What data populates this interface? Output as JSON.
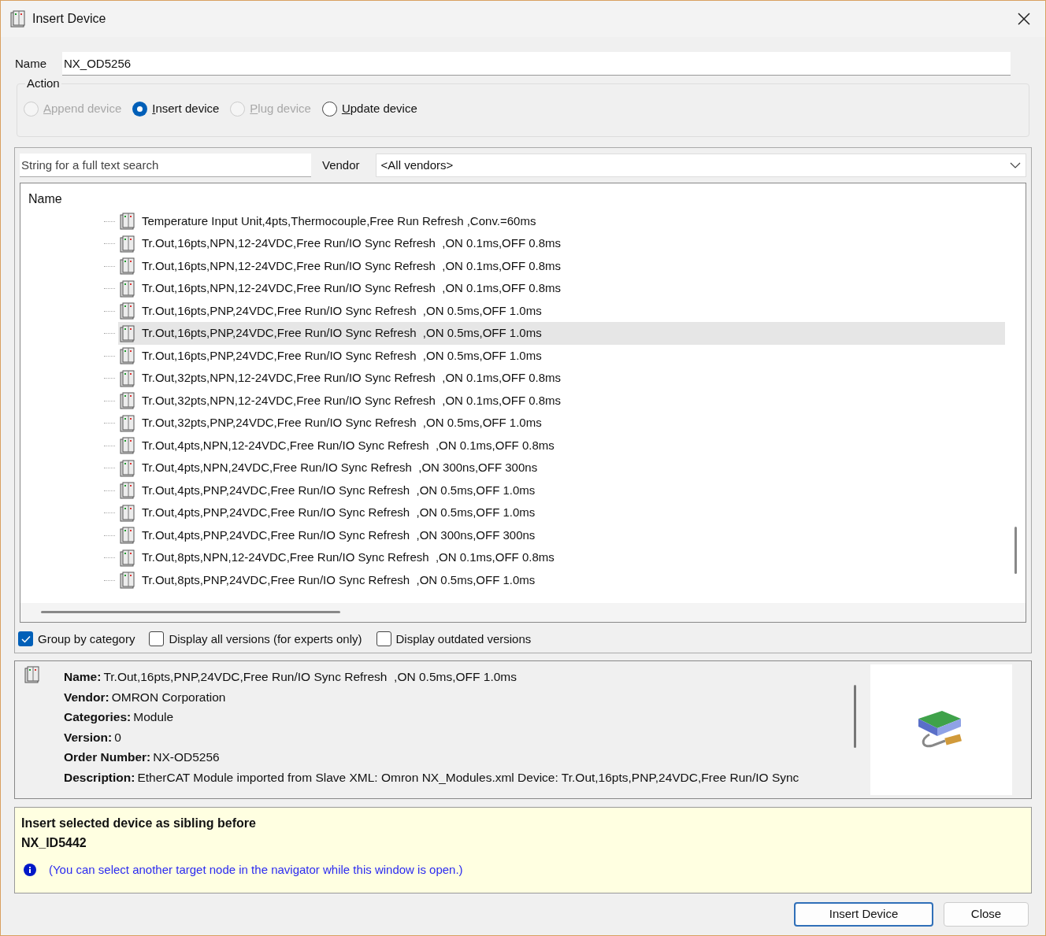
{
  "window": {
    "title": "Insert Device"
  },
  "name_field": {
    "label": "Name",
    "value": "NX_OD5256"
  },
  "action": {
    "title": "Action",
    "options": [
      {
        "key": "A",
        "rest": "ppend device",
        "selected": false,
        "disabled": true
      },
      {
        "key": "I",
        "rest": "nsert device",
        "selected": true,
        "disabled": false
      },
      {
        "key": "P",
        "rest": "lug device",
        "selected": false,
        "disabled": true
      },
      {
        "key": "U",
        "rest": "pdate device",
        "selected": false,
        "disabled": false
      }
    ]
  },
  "search": {
    "placeholder": "String for a full text search"
  },
  "vendor": {
    "label": "Vendor",
    "value": "<All vendors>"
  },
  "tree": {
    "column": "Name",
    "items": [
      {
        "label": "Temperature Input Unit,4pts,Thermocouple,Free Run Refresh ,Conv.=60ms",
        "selected": false
      },
      {
        "label": "Tr.Out,16pts,NPN,12-24VDC,Free Run/IO Sync Refresh  ,ON 0.1ms,OFF 0.8ms",
        "selected": false
      },
      {
        "label": "Tr.Out,16pts,NPN,12-24VDC,Free Run/IO Sync Refresh  ,ON 0.1ms,OFF 0.8ms",
        "selected": false
      },
      {
        "label": "Tr.Out,16pts,NPN,12-24VDC,Free Run/IO Sync Refresh  ,ON 0.1ms,OFF 0.8ms",
        "selected": false
      },
      {
        "label": "Tr.Out,16pts,PNP,24VDC,Free Run/IO Sync Refresh  ,ON 0.5ms,OFF 1.0ms",
        "selected": false
      },
      {
        "label": "Tr.Out,16pts,PNP,24VDC,Free Run/IO Sync Refresh  ,ON 0.5ms,OFF 1.0ms",
        "selected": true
      },
      {
        "label": "Tr.Out,16pts,PNP,24VDC,Free Run/IO Sync Refresh  ,ON 0.5ms,OFF 1.0ms",
        "selected": false
      },
      {
        "label": "Tr.Out,32pts,NPN,12-24VDC,Free Run/IO Sync Refresh  ,ON 0.1ms,OFF 0.8ms",
        "selected": false
      },
      {
        "label": "Tr.Out,32pts,NPN,12-24VDC,Free Run/IO Sync Refresh  ,ON 0.1ms,OFF 0.8ms",
        "selected": false
      },
      {
        "label": "Tr.Out,32pts,PNP,24VDC,Free Run/IO Sync Refresh  ,ON 0.5ms,OFF 1.0ms",
        "selected": false
      },
      {
        "label": "Tr.Out,4pts,NPN,12-24VDC,Free Run/IO Sync Refresh  ,ON 0.1ms,OFF 0.8ms",
        "selected": false
      },
      {
        "label": "Tr.Out,4pts,NPN,24VDC,Free Run/IO Sync Refresh  ,ON 300ns,OFF 300ns",
        "selected": false
      },
      {
        "label": "Tr.Out,4pts,PNP,24VDC,Free Run/IO Sync Refresh  ,ON 0.5ms,OFF 1.0ms",
        "selected": false
      },
      {
        "label": "Tr.Out,4pts,PNP,24VDC,Free Run/IO Sync Refresh  ,ON 0.5ms,OFF 1.0ms",
        "selected": false
      },
      {
        "label": "Tr.Out,4pts,PNP,24VDC,Free Run/IO Sync Refresh  ,ON 300ns,OFF 300ns",
        "selected": false
      },
      {
        "label": "Tr.Out,8pts,NPN,12-24VDC,Free Run/IO Sync Refresh  ,ON 0.1ms,OFF 0.8ms",
        "selected": false
      },
      {
        "label": "Tr.Out,8pts,PNP,24VDC,Free Run/IO Sync Refresh  ,ON 0.5ms,OFF 1.0ms",
        "selected": false
      }
    ]
  },
  "options": [
    {
      "label": "Group by category",
      "checked": true
    },
    {
      "label": "Display all versions (for experts only)",
      "checked": false
    },
    {
      "label": "Display outdated versions",
      "checked": false
    }
  ],
  "details": [
    {
      "label": "Name:",
      "value": "Tr.Out,16pts,PNP,24VDC,Free Run/IO Sync Refresh  ,ON 0.5ms,OFF 1.0ms"
    },
    {
      "label": "Vendor:",
      "value": "OMRON Corporation"
    },
    {
      "label": "Categories:",
      "value": "Module"
    },
    {
      "label": "Version:",
      "value": "0"
    },
    {
      "label": "Order Number:",
      "value": "NX-OD5256"
    },
    {
      "label": "Description:",
      "value": "EtherCAT Module imported from Slave XML: Omron NX_Modules.xml Device: Tr.Out,16pts,PNP,24VDC,Free Run/IO Sync"
    }
  ],
  "info": {
    "line1": "Insert selected device as sibling before",
    "line2": "NX_ID5442",
    "hint": "(You can select another target node in the navigator while this window is open.)"
  },
  "buttons": [
    {
      "label": "Insert Device",
      "default": true
    },
    {
      "label": "Close",
      "default": false
    }
  ]
}
